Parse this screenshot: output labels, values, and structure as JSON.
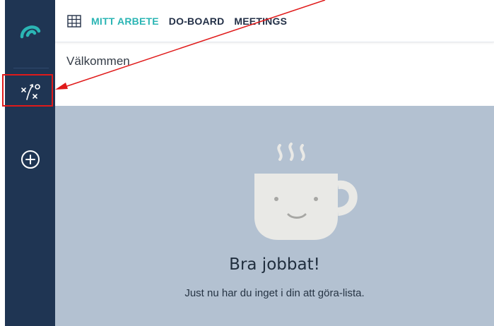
{
  "colors": {
    "sidebar_bg": "#1f3553",
    "accent": "#2bb5b4",
    "panel_bg": "#b3c1d1",
    "annotation": "#e01a1a"
  },
  "sidebar": {
    "logo_icon": "wave-logo-icon",
    "items": [
      {
        "icon": "strategy-play-icon"
      },
      {
        "icon": "add-circle-icon"
      }
    ]
  },
  "topbar": {
    "grid_icon": "grid-icon",
    "tabs": [
      {
        "label": "MITT ARBETE",
        "active": true
      },
      {
        "label": "DO-BOARD",
        "active": false
      },
      {
        "label": "MEETINGS",
        "active": false
      }
    ]
  },
  "main": {
    "heading": "Välkommen",
    "empty_state": {
      "icon": "coffee-cup-icon",
      "title": "Bra jobbat!",
      "subtitle": "Just nu har du inget i din att göra-lista."
    }
  }
}
